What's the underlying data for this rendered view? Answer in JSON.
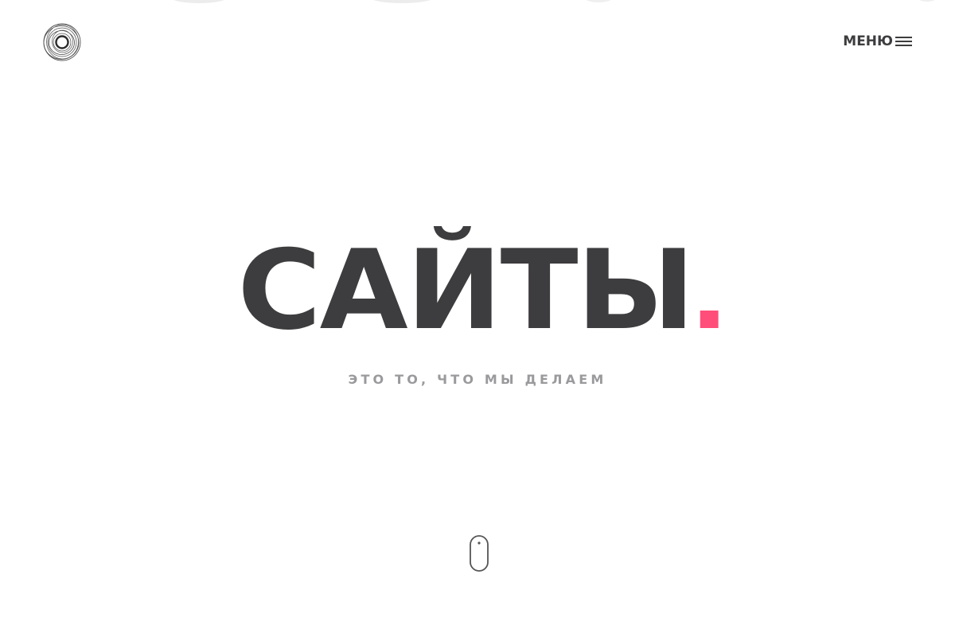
{
  "header": {
    "logo_icon": "spiral-logo-icon",
    "menu_label": "МЕНЮ",
    "menu_icon": "hamburger-icon"
  },
  "hero": {
    "title": "САЙТЫ",
    "accent_dot_color": "#ff4e7a",
    "subtitle": "ЭТО ТО, ЧТО МЫ ДЕЛАЕМ"
  },
  "scroll_indicator": {
    "icon": "mouse-scroll-icon"
  },
  "colors": {
    "text_primary": "#3d3c3e",
    "text_secondary": "#9a999c",
    "accent": "#ff4e7a",
    "background": "#ffffff"
  }
}
